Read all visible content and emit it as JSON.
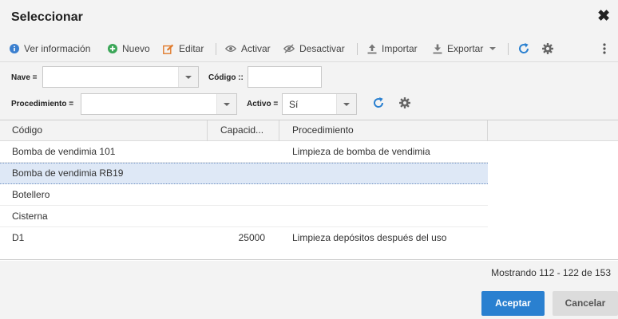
{
  "dialog": {
    "title": "Seleccionar",
    "close_icon": "close-icon"
  },
  "toolbar": {
    "ver_info": "Ver información",
    "nuevo": "Nuevo",
    "editar": "Editar",
    "activar": "Activar",
    "desactivar": "Desactivar",
    "importar": "Importar",
    "exportar": "Exportar"
  },
  "filters": {
    "nave_label": "Nave =",
    "nave_value": "",
    "codigo_label": "Código ::",
    "codigo_value": "",
    "procedimiento_label": "Procedimiento =",
    "procedimiento_value": "",
    "activo_label": "Activo =",
    "activo_value": "Sí"
  },
  "grid": {
    "columns": [
      "Código",
      "Capacid...",
      "Procedimiento"
    ],
    "rows": [
      {
        "codigo": "Bomba de vendimia 101",
        "capacidad": "",
        "procedimiento": "Limpieza de bomba de vendimia"
      },
      {
        "codigo": "Bomba de vendimia RB19",
        "capacidad": "",
        "procedimiento": ""
      },
      {
        "codigo": "Botellero",
        "capacidad": "",
        "procedimiento": ""
      },
      {
        "codigo": "Cisterna",
        "capacidad": "",
        "procedimiento": ""
      },
      {
        "codigo": "D1",
        "capacidad": "25000",
        "procedimiento": "Limpieza depósitos después del uso"
      }
    ]
  },
  "footer": {
    "count": "Mostrando 112 - 122 de 153",
    "accept": "Aceptar",
    "cancel": "Cancelar"
  },
  "colors": {
    "accent": "#2a80d0",
    "green": "#3aa657",
    "orange": "#e07b2c",
    "info_blue": "#3a7fcf",
    "selected_row": "#dee8f6"
  }
}
